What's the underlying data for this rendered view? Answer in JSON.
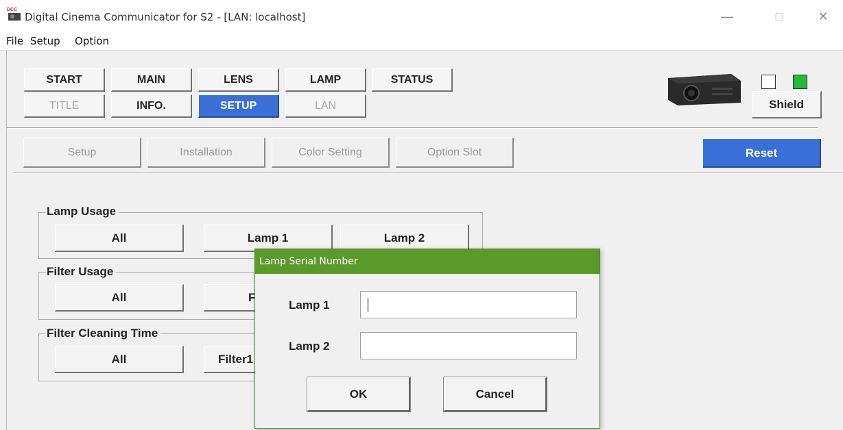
{
  "window": {
    "title": "Digital Cinema Communicator for S2 - [LAN: localhost]",
    "minimize": "—",
    "maximize": "□",
    "close": "✕"
  },
  "menu": [
    "File",
    "Setup",
    "Option"
  ],
  "tabs_row1": [
    "START",
    "MAIN",
    "LENS",
    "LAMP",
    "STATUS"
  ],
  "tabs_row2": [
    "TITLE",
    "INFO.",
    "SETUP",
    "LAN"
  ],
  "active_tab": "SETUP",
  "subtabs": [
    "Setup",
    "Installation",
    "Color Setting",
    "Option Slot"
  ],
  "reset_label": "Reset",
  "shield_label": "Shield",
  "indicators": {
    "left_color": "#ffffff",
    "right_color": "#22bb33"
  },
  "groups": {
    "lamp_usage": {
      "label": "Lamp Usage",
      "buttons": [
        "All",
        "Lamp 1",
        "Lamp 2"
      ]
    },
    "filter_usage": {
      "label": "Filter Usage",
      "buttons": [
        "All",
        "F"
      ]
    },
    "filter_cleaning": {
      "label": "Filter Cleaning Time",
      "buttons": [
        "All",
        "Filter1"
      ]
    }
  },
  "dialog": {
    "title": "Lamp Serial Number",
    "lamp1_label": "Lamp 1",
    "lamp2_label": "Lamp 2",
    "lamp1_value": "",
    "lamp2_value": "",
    "ok_label": "OK",
    "cancel_label": "Cancel"
  },
  "colors": {
    "accent": "#3a6fd8",
    "dialog_title": "#5a9a2a"
  }
}
